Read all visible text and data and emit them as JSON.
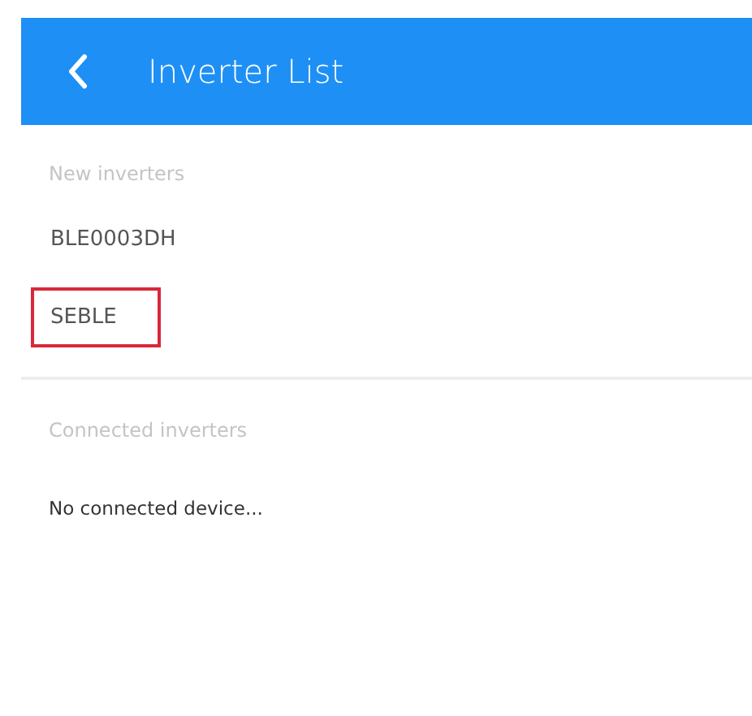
{
  "header": {
    "title": "Inverter List"
  },
  "new_inverters": {
    "label": "New inverters",
    "items": [
      {
        "name": "BLE0003DH",
        "highlighted": false
      },
      {
        "name": "SEBLE",
        "highlighted": true
      }
    ]
  },
  "connected_inverters": {
    "label": "Connected inverters",
    "empty_message": "No connected device..."
  }
}
